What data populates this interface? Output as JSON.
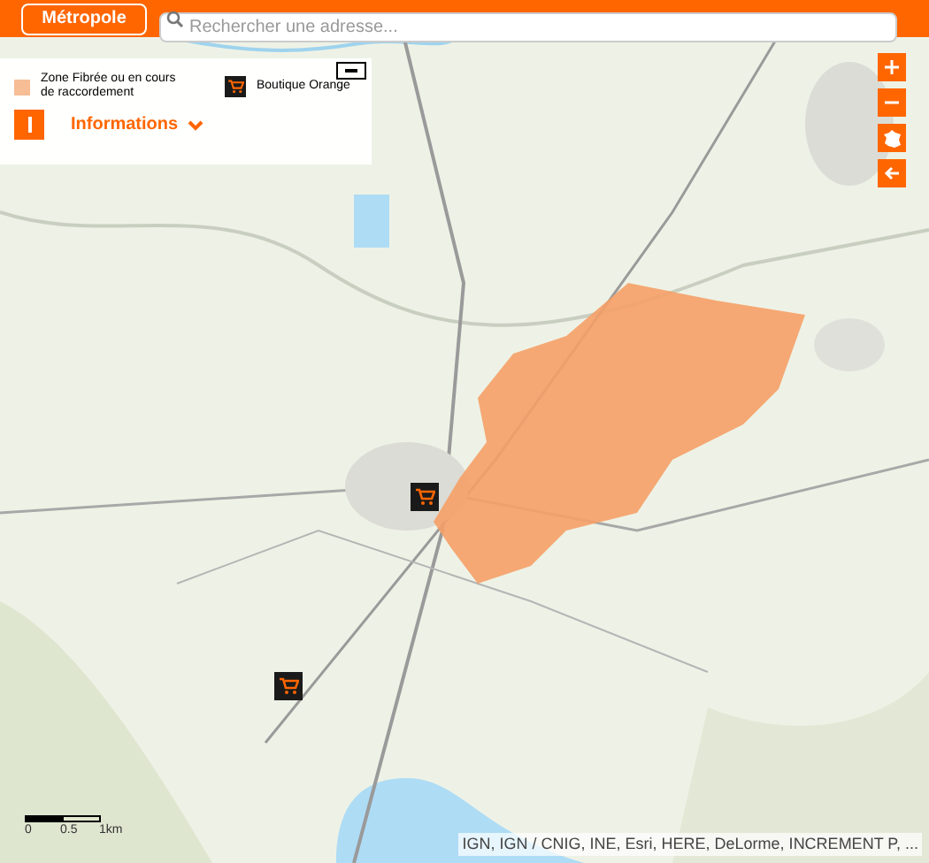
{
  "top_bar": {
    "button": "Métropole",
    "search": {
      "placeholder": "Rechercher une adresse..."
    }
  },
  "legend": {
    "items": [
      {
        "kind": "zone",
        "label": "Zone Fibrée ou en cours de raccordement"
      },
      {
        "kind": "shop",
        "label": "Boutique Orange"
      }
    ],
    "info_label": "Informations",
    "expanded": true
  },
  "scale_bar": {
    "labels": [
      "0",
      "0.5",
      "1km"
    ]
  },
  "attribution": "IGN, IGN / CNIG, INE, Esri, HERE, DeLorme, INCREMENT P, ..."
}
